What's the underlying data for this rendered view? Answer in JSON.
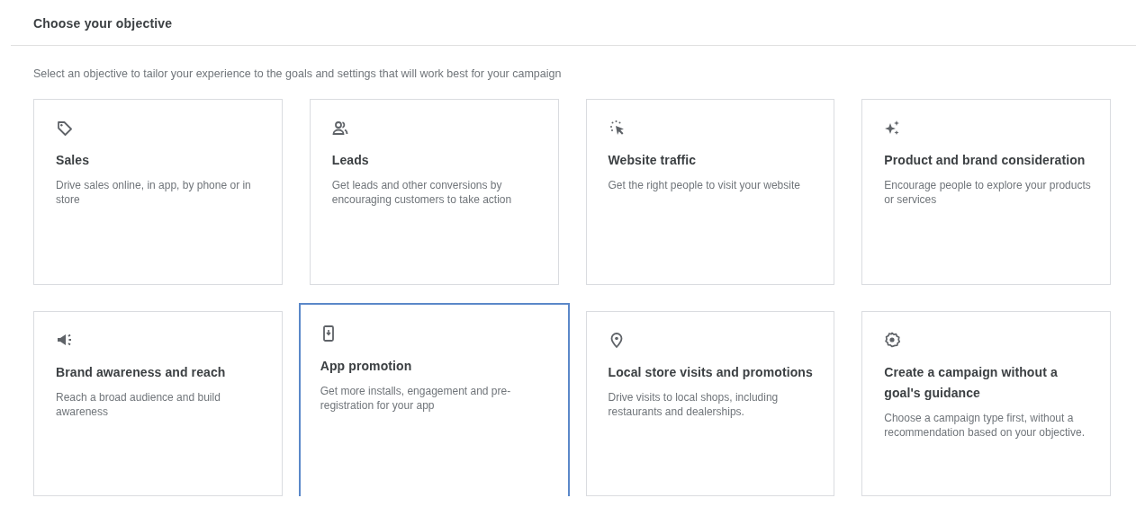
{
  "header": {
    "title": "Choose your objective"
  },
  "subtitle": "Select an objective to tailor your experience to the goals and settings that will work best for your campaign",
  "objectives": [
    {
      "kind": "tag",
      "title": "Sales",
      "description": "Drive sales online, in app, by phone or in store",
      "selected": false
    },
    {
      "kind": "people",
      "title": "Leads",
      "description": "Get leads and other conversions by encouraging customers to take action",
      "selected": false
    },
    {
      "kind": "cursor",
      "title": "Website traffic",
      "description": "Get the right people to visit your website",
      "selected": false
    },
    {
      "kind": "sparkle",
      "title": "Product and brand consideration",
      "description": "Encourage people to explore your products or services",
      "selected": false
    },
    {
      "kind": "megaphone",
      "title": "Brand awareness and reach",
      "description": "Reach a broad audience and build awareness",
      "selected": false
    },
    {
      "kind": "phone",
      "title": "App promotion",
      "description": "Get more installs, engagement and pre-registration for your app",
      "selected": true
    },
    {
      "kind": "pin",
      "title": "Local store visits and promotions",
      "description": "Drive visits to local shops, including restaurants and dealerships.",
      "selected": false
    },
    {
      "kind": "gear",
      "title": "Create a campaign without a goal's guidance",
      "description": "Choose a campaign type first, without a recommendation based on your objective.",
      "selected": false
    }
  ]
}
